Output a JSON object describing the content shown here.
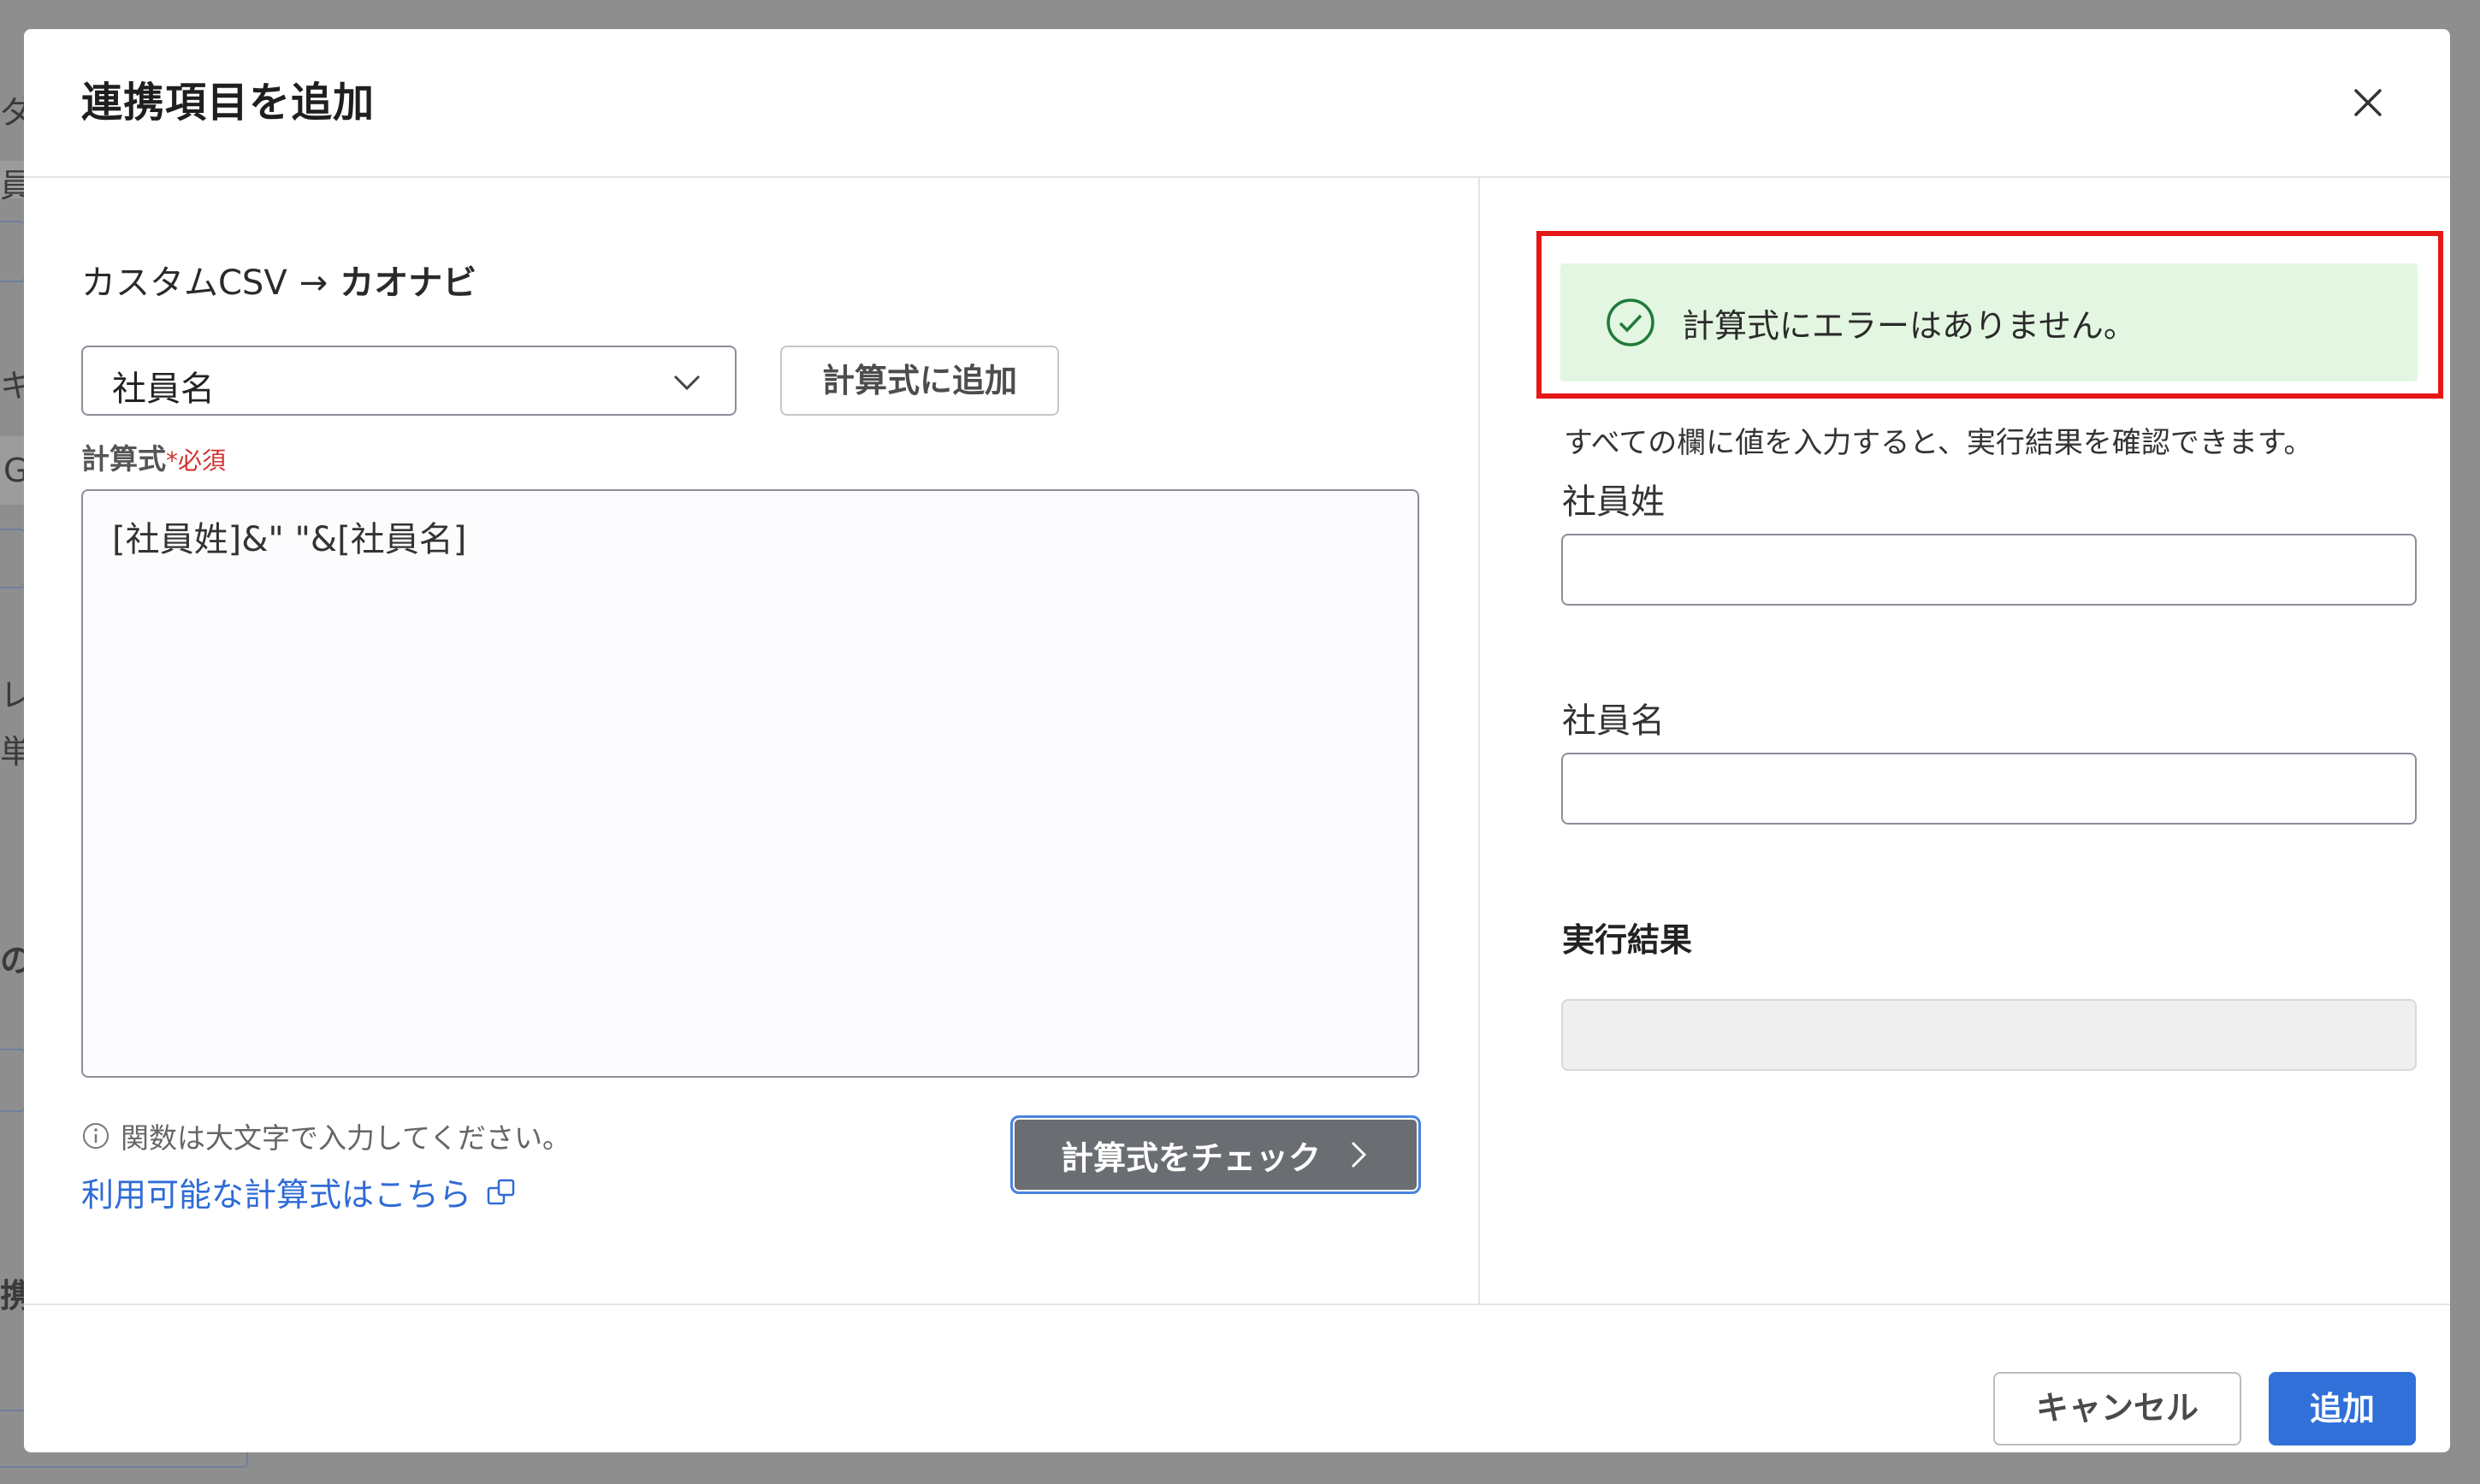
{
  "background": {
    "fragments": [
      "ダ",
      "員",
      "キ",
      "G",
      "レ",
      "単",
      "の追",
      "携"
    ]
  },
  "dialog": {
    "title": "連携項目を追加",
    "close_icon": "close-icon"
  },
  "mapping": {
    "source": "カスタムCSV",
    "arrow": "→",
    "target": "カオナビ"
  },
  "field_select": {
    "value": "社員名",
    "icon": "chevron-down-icon"
  },
  "add_to_formula_button": "計算式に追加",
  "formula": {
    "label": "計算式",
    "required_marker": "*",
    "required_text": "必須",
    "value": "[社員姓]&\" \"&[社員名]"
  },
  "hint": {
    "icon": "info-icon",
    "text": "関数は大文字で入力してください。"
  },
  "help_link": {
    "text": "利用可能な計算式はこちら",
    "icon": "external-link-icon"
  },
  "check_button": {
    "label": "計算式をチェック",
    "icon": "chevron-right-icon"
  },
  "result_panel": {
    "success_icon": "check-circle-icon",
    "success_message": "計算式にエラーはありません。",
    "description": "すべての欄に値を入力すると、実行結果を確認できます。",
    "fields": [
      {
        "label": "社員姓",
        "value": ""
      },
      {
        "label": "社員名",
        "value": ""
      }
    ],
    "result_label": "実行結果",
    "result_value": ""
  },
  "footer": {
    "cancel_label": "キャンセル",
    "submit_label": "追加"
  },
  "colors": {
    "accent": "#3170d8",
    "success_bg": "#e3f6e1",
    "success_icon": "#1e7a3a",
    "highlight": "#e51818",
    "required": "#d0332e"
  }
}
